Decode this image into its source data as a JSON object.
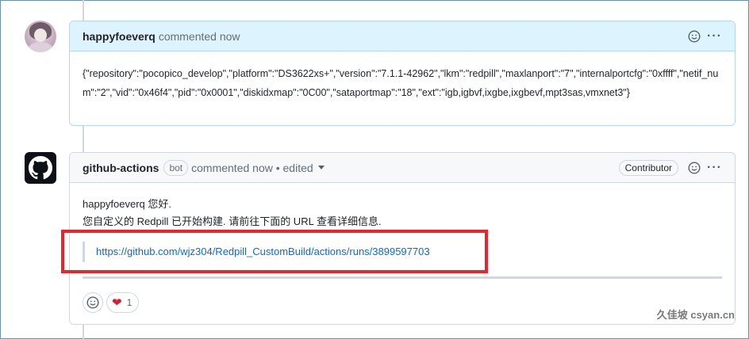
{
  "comments": [
    {
      "author": "happyfoeverq",
      "meta": "commented now",
      "body": "{\"repository\":\"pocopico_develop\",\"platform\":\"DS3622xs+\",\"version\":\"7.1.1-42962\",\"lkm\":\"redpill\",\"maxlanport\":\"7\",\"internalportcfg\":\"0xffff\",\"netif_num\":\"2\",\"vid\":\"0x46f4\",\"pid\":\"0x0001\",\"diskidxmap\":\"0C00\",\"sataportmap\":\"18\",\"ext\":\"igb,igbvf,ixgbe,ixgbevf,mpt3sas,vmxnet3\"}"
    },
    {
      "author": "github-actions",
      "badge": "bot",
      "meta": "commented now • edited",
      "role": "Contributor",
      "greeting": "happyfoeverq 您好.",
      "message": "您自定义的 Redpill 已开始构建. 请前往下面的 URL 查看详细信息.",
      "link": "https://github.com/wjz304/Redpill_CustomBuild/actions/runs/3899597703",
      "heart_count": "1"
    }
  ],
  "watermark": "久佳坡 csyan.cn",
  "colors": {
    "accent": "#0969da",
    "highlight": "#e8252b",
    "heart": "#cf222e"
  }
}
